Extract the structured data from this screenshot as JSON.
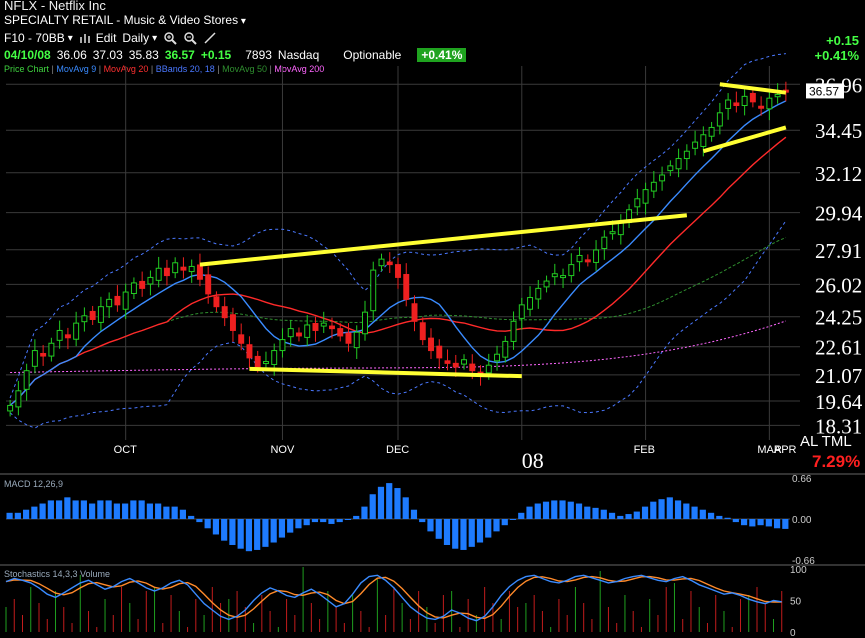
{
  "header": {
    "title": "NFLX - Netflix Inc",
    "industry": "SPECIALTY RETAIL - Music & Video Stores",
    "layout_name": "F10 - 70BB",
    "edit_label": "Edit",
    "period": "Daily",
    "date": "04/10/08",
    "open": "36.06",
    "high": "37.03",
    "low": "35.83",
    "close": "36.57",
    "change": "+0.15",
    "volume": "7893",
    "exchange": "Nasdaq",
    "optionable": "Optionable",
    "pct_change": "+0.41%",
    "right_change": "+0.15",
    "right_pct": "+0.41%"
  },
  "legend": {
    "items": [
      {
        "label": "Price Chart",
        "color": "#3fd23f"
      },
      {
        "label": "MovAvg 9",
        "color": "#3a8bff"
      },
      {
        "label": "MovAvg 20",
        "color": "#ff3030"
      },
      {
        "label": "BBands 20, 18",
        "color": "#4a78ff"
      },
      {
        "label": "MovAvg 50",
        "color": "#2f8f2f"
      },
      {
        "label": "MovAvg 200",
        "color": "#ff66ff"
      }
    ]
  },
  "ticker_badge": {
    "text": "AL TML",
    "pct": "7.29%"
  },
  "colors": {
    "up": "#22cc22",
    "down": "#ee2020",
    "trendline": "#ffff33",
    "macd": "#1e7bff",
    "grid": "#3a3a3a"
  },
  "icons": [
    "zoom-in-icon",
    "zoom-out-icon",
    "draw-line-icon",
    "bars-icon"
  ],
  "chart_data": [
    {
      "type": "candlestick",
      "price_axis": [
        "36.96",
        "34.45",
        "32.12",
        "29.94",
        "27.91",
        "26.02",
        "24.25",
        "22.61",
        "21.07",
        "19.64",
        "18.31"
      ],
      "price_label": "36.57",
      "month_labels": [
        "OCT",
        "NOV",
        "DEC",
        "08",
        "FEB",
        "MAR",
        "APR"
      ],
      "ylim": [
        18.31,
        36.96
      ],
      "closes": [
        19.4,
        20.2,
        21.3,
        22.4,
        22.1,
        22.8,
        23.5,
        23.1,
        23.9,
        24.3,
        24.1,
        24.8,
        25.2,
        24.9,
        25.6,
        26.1,
        25.8,
        26.4,
        26.9,
        26.5,
        27.2,
        26.8,
        27.0,
        26.3,
        25.5,
        24.8,
        24.2,
        23.5,
        22.8,
        22.0,
        21.5,
        21.8,
        22.4,
        23.0,
        23.6,
        23.2,
        23.8,
        23.5,
        23.9,
        23.6,
        23.2,
        22.8,
        23.4,
        24.5,
        26.8,
        27.4,
        27.1,
        26.4,
        25.2,
        24.0,
        23.0,
        22.4,
        22.0,
        21.7,
        21.5,
        21.9,
        21.3,
        21.1,
        21.6,
        22.2,
        22.9,
        24.0,
        24.9,
        25.3,
        25.8,
        26.2,
        26.6,
        26.5,
        27.1,
        27.6,
        27.3,
        27.9,
        28.6,
        28.9,
        29.4,
        30.1,
        30.7,
        31.2,
        31.6,
        32.0,
        32.5,
        32.9,
        33.3,
        33.8,
        34.2,
        34.6,
        35.4,
        36.1,
        35.8,
        36.3,
        36.0,
        35.7,
        36.2,
        36.4,
        36.57
      ],
      "trendlines": [
        {
          "from": [
            23,
            27.1
          ],
          "to": [
            82,
            29.8
          ]
        },
        {
          "from": [
            29,
            21.4
          ],
          "to": [
            62,
            21.0
          ]
        },
        {
          "from": [
            86,
            36.96
          ],
          "to": [
            94,
            36.5
          ]
        },
        {
          "from": [
            84,
            33.3
          ],
          "to": [
            94,
            34.6
          ]
        }
      ]
    },
    {
      "type": "bar",
      "title": "MACD 12,26,9",
      "axis": [
        "0.66",
        "0.00",
        "-0.66"
      ],
      "ylim": [
        -0.66,
        0.66
      ],
      "values": [
        0.1,
        0.1,
        0.15,
        0.2,
        0.25,
        0.3,
        0.3,
        0.35,
        0.3,
        0.3,
        0.25,
        0.3,
        0.3,
        0.25,
        0.25,
        0.3,
        0.3,
        0.25,
        0.25,
        0.2,
        0.2,
        0.15,
        0.05,
        -0.05,
        -0.15,
        -0.25,
        -0.35,
        -0.42,
        -0.48,
        -0.52,
        -0.5,
        -0.45,
        -0.38,
        -0.3,
        -0.22,
        -0.15,
        -0.1,
        -0.05,
        -0.05,
        -0.08,
        -0.05,
        0.0,
        0.05,
        0.2,
        0.4,
        0.52,
        0.58,
        0.5,
        0.35,
        0.15,
        -0.05,
        -0.2,
        -0.32,
        -0.42,
        -0.48,
        -0.5,
        -0.45,
        -0.38,
        -0.3,
        -0.2,
        -0.1,
        0.0,
        0.1,
        0.2,
        0.25,
        0.28,
        0.3,
        0.3,
        0.28,
        0.25,
        0.2,
        0.18,
        0.15,
        0.1,
        0.05,
        0.08,
        0.12,
        0.2,
        0.28,
        0.32,
        0.35,
        0.3,
        0.25,
        0.2,
        0.15,
        0.1,
        0.05,
        0.02,
        -0.05,
        -0.1,
        -0.12,
        -0.1,
        -0.12,
        -0.15,
        -0.16
      ]
    },
    {
      "type": "line",
      "title": "Stochastics 14,3,3 Volume",
      "axis": [
        "100",
        "50",
        "0"
      ],
      "ylim": [
        0,
        100
      ],
      "values": [
        80,
        85,
        82,
        78,
        70,
        60,
        55,
        62,
        70,
        78,
        82,
        75,
        68,
        72,
        80,
        85,
        78,
        70,
        65,
        70,
        78,
        82,
        75,
        60,
        45,
        35,
        25,
        20,
        25,
        35,
        50,
        62,
        70,
        65,
        58,
        55,
        62,
        68,
        60,
        50,
        40,
        45,
        60,
        78,
        88,
        90,
        82,
        70,
        55,
        40,
        30,
        22,
        20,
        25,
        35,
        30,
        22,
        18,
        25,
        40,
        58,
        72,
        82,
        88,
        90,
        85,
        80,
        78,
        82,
        88,
        90,
        86,
        82,
        78,
        80,
        85,
        88,
        90,
        86,
        82,
        80,
        85,
        88,
        82,
        75,
        70,
        65,
        60,
        62,
        58,
        52,
        48,
        45,
        50,
        48
      ]
    }
  ]
}
